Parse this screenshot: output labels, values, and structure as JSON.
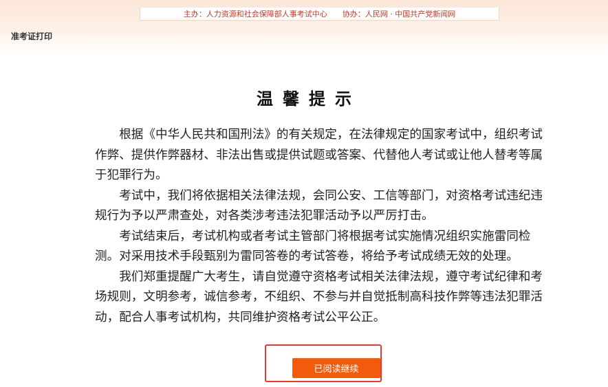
{
  "header": {
    "sponsor": "主办：人力资源和社会保障部人事考试中心",
    "co_sponsor": "协办：人民网 · 中国共产党新闻网",
    "page_label": "准考证打印"
  },
  "notice": {
    "title": "温馨提示",
    "paragraphs": [
      "根据《中华人民共和国刑法》的有关规定，在法律规定的国家考试中，组织考试作弊、提供作弊器材、非法出售或提供试题或答案、代替他人考试或让他人替考等属于犯罪行为。",
      "考试中，我们将依据相关法律法规，会同公安、工信等部门，对资格考试违纪违规行为予以严肃查处，对各类涉考违法犯罪活动予以严厉打击。",
      "考试结束后，考试机构或者考试主管部门将根据考试实施情况组织实施雷同检测。对采用技术手段甄别为雷同答卷的考试答卷，将给予考试成绩无效的处理。",
      "我们郑重提醒广大考生，请自觉遵守资格考试相关法律法规，遵守考试纪律和考场规则，文明参考，诚信参考，不组织、不参与并自觉抵制高科技作弊等违法犯罪活动，配合人事考试机构，共同维护资格考试公平公正。"
    ]
  },
  "actions": {
    "continue_label": "已阅读继续"
  },
  "colors": {
    "button": "#f25a0c",
    "highlight_border": "#e53935",
    "sponsor_text": "#c0392b"
  }
}
